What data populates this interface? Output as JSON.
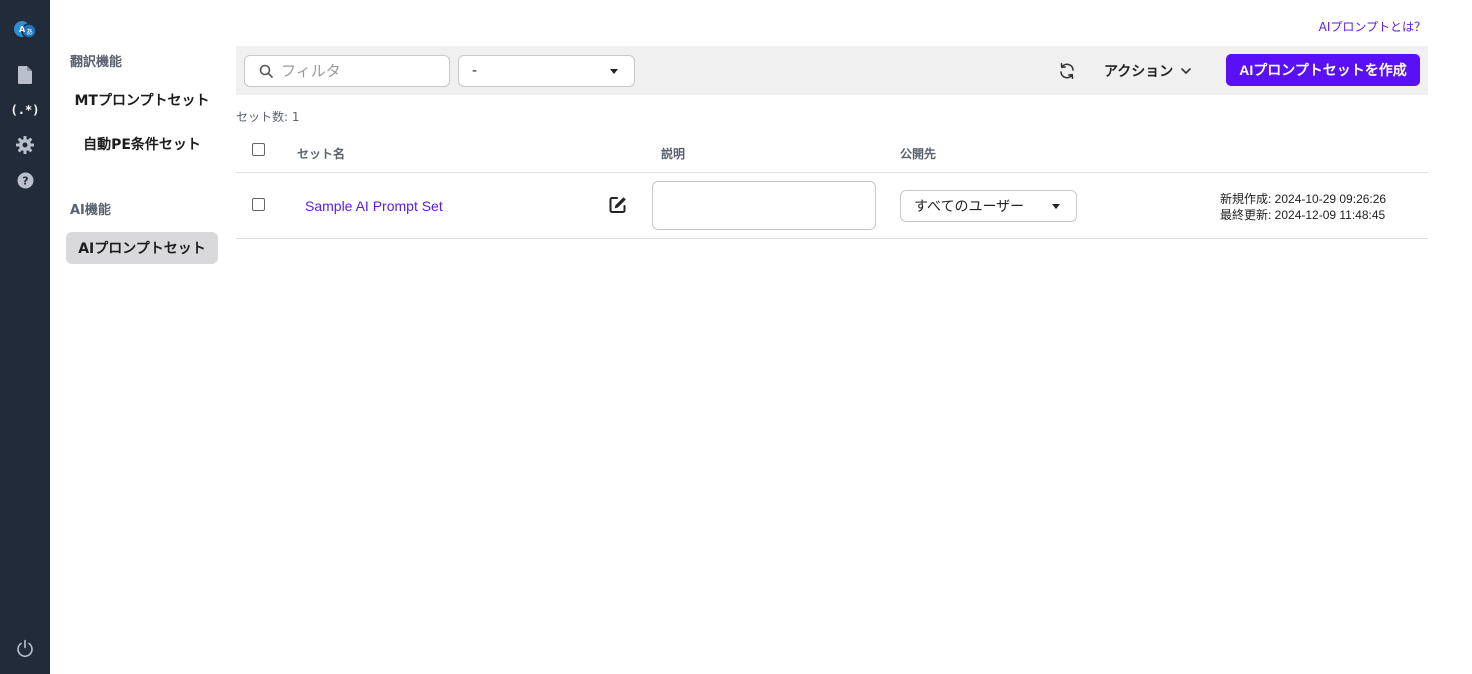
{
  "help_link": "AIプロンプトとは？",
  "rail": {
    "items": [
      {
        "icon": "app-logo-icon"
      },
      {
        "icon": "document-icon"
      },
      {
        "icon": "regex-icon",
        "label": "(.*)"
      },
      {
        "icon": "gear-icon"
      },
      {
        "icon": "help-icon"
      },
      {
        "icon": "power-icon"
      }
    ]
  },
  "subnav": {
    "sections": [
      {
        "heading": "翻訳機能",
        "items": [
          "MTプロンプトセット",
          "自動PE条件セット"
        ]
      },
      {
        "heading": "AI機能",
        "items": [
          "AIプロンプトセット"
        ]
      }
    ],
    "active": "AIプロンプトセット"
  },
  "toolbar": {
    "filter_placeholder": "フィルタ",
    "filter_value": "",
    "scope_value": "-",
    "action_label": "アクション",
    "create_label": "AIプロンプトセットを作成"
  },
  "count_label": "セット数: 1",
  "table": {
    "headers": {
      "name": "セット名",
      "description": "説明",
      "publish": "公開先"
    },
    "rows": [
      {
        "name": "Sample AI Prompt Set",
        "description": "",
        "publish_to": "すべてのユーザー",
        "created": "新規作成: 2024-10-29 09:26:26",
        "updated": "最終更新: 2024-12-09 11:48:45"
      }
    ]
  },
  "colors": {
    "accent": "#5a10f6",
    "rail": "#212b3a",
    "link": "#5a1cf2"
  }
}
